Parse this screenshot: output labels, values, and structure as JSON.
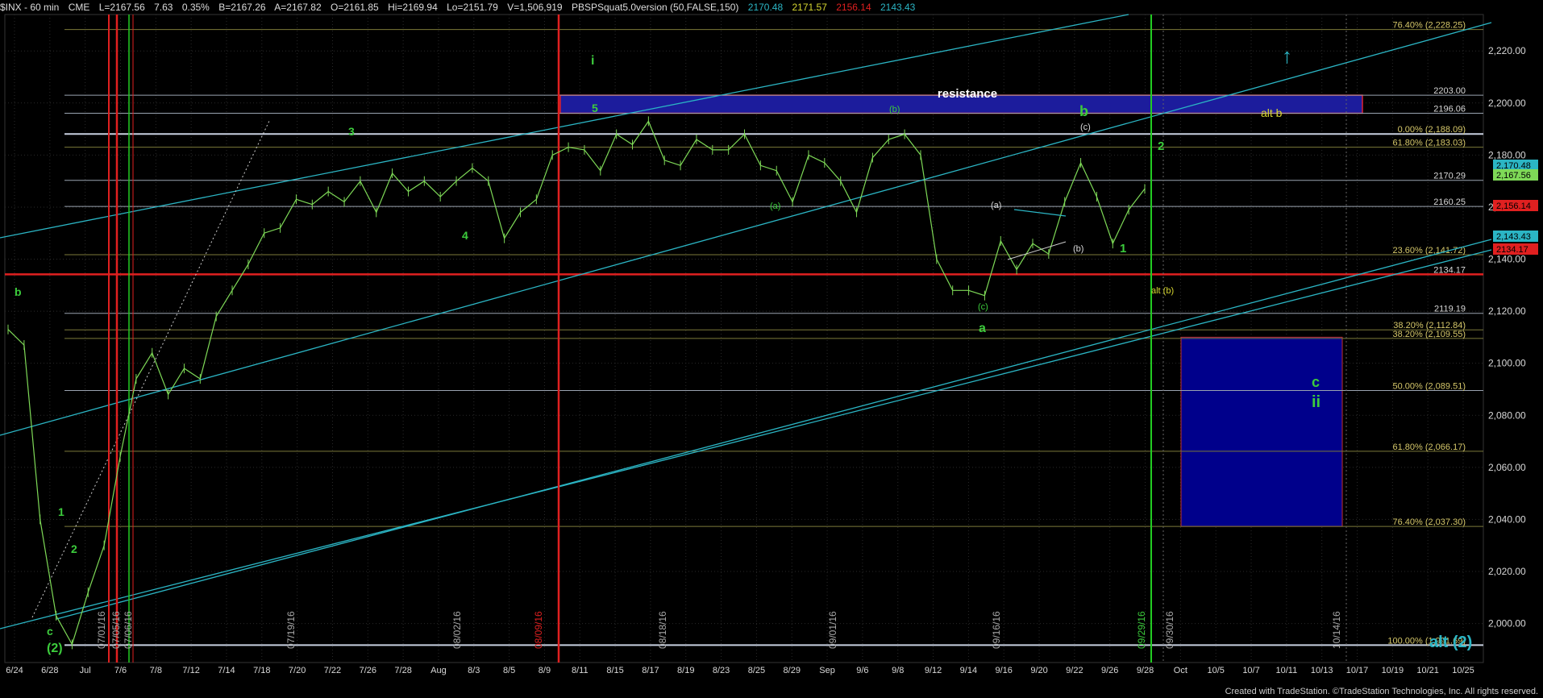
{
  "header": {
    "symbol": "$INX - 60 min",
    "exchange": "CME",
    "last": "L=2167.56",
    "change": "7.63",
    "change_pct": "0.35%",
    "bid": "B=2167.26",
    "ask": "A=2167.82",
    "open": "O=2161.85",
    "high": "Hi=2169.94",
    "low": "Lo=2151.79",
    "volume": "V=1,506,919",
    "study": "PBSPSquat5.0version (50,FALSE,150)",
    "study_v1": "2170.48",
    "study_v2": "2171.57",
    "study_v3": "2156.14",
    "study_v4": "2143.43"
  },
  "colors": {
    "background": "#000000",
    "price_bar": "#7ed957",
    "channel": "#2bb5c4",
    "red_line": "#e02020",
    "green_line": "#22cc22",
    "grey_line": "#9aa3b0",
    "olive_line": "#7c7a3a",
    "resistance_fill": "#1c1c9c",
    "target_box_fill": "#00008b",
    "label_green": "#3ccc3c",
    "label_white": "#d8d8d8",
    "label_yellow": "#d6d630"
  },
  "credits": "Created with TradeStation. ©TradeStation Technologies, Inc. All rights reserved.",
  "chart_data": {
    "type": "line",
    "title": "$INX - 60 min",
    "y_axis": {
      "ylim": [
        1985,
        2234
      ],
      "ticks": [
        "2,000.00",
        "2,020.00",
        "2,040.00",
        "2,060.00",
        "2,080.00",
        "2,100.00",
        "2,120.00",
        "2,140.00",
        "2,160.00",
        "2,180.00",
        "2,200.00",
        "2,220.00"
      ]
    },
    "x_axis": {
      "ticks": [
        "6/24",
        "6/28",
        "Jul",
        "7/6",
        "7/8",
        "7/12",
        "7/14",
        "7/18",
        "7/20",
        "7/22",
        "7/26",
        "7/28",
        "Aug",
        "8/3",
        "8/5",
        "8/9",
        "8/11",
        "8/15",
        "8/17",
        "8/19",
        "8/23",
        "8/25",
        "8/29",
        "Sep",
        "9/6",
        "9/8",
        "9/12",
        "9/14",
        "9/16",
        "9/20",
        "9/22",
        "9/26",
        "9/28",
        "Oct",
        "10/5",
        "10/7",
        "10/11",
        "10/13",
        "10/17",
        "10/19",
        "10/21",
        "10/25"
      ],
      "vertical_date_labels": [
        "07/01/16",
        "07/05/16",
        "07/06/16",
        "07/19/16",
        "08/02/16",
        "08/09/16",
        "08/18/16",
        "09/01/16",
        "09/16/16",
        "09/29/16",
        "09/30/16",
        "10/14/16"
      ]
    },
    "series": [
      {
        "name": "$INX",
        "points": [
          [
            "6/24",
            2113
          ],
          [
            "6/24",
            2107
          ],
          [
            "6/27",
            2040
          ],
          [
            "6/27",
            2003
          ],
          [
            "6/28",
            1992
          ],
          [
            "6/28",
            2012
          ],
          [
            "6/29",
            2030
          ],
          [
            "6/30",
            2064
          ],
          [
            "7/1",
            2094
          ],
          [
            "7/1",
            2104
          ],
          [
            "7/5",
            2088
          ],
          [
            "7/6",
            2098
          ],
          [
            "7/7",
            2094
          ],
          [
            "7/8",
            2118
          ],
          [
            "7/8",
            2128
          ],
          [
            "7/11",
            2138
          ],
          [
            "7/12",
            2150
          ],
          [
            "7/13",
            2152
          ],
          [
            "7/14",
            2163
          ],
          [
            "7/15",
            2161
          ],
          [
            "7/18",
            2166
          ],
          [
            "7/19",
            2162
          ],
          [
            "7/20",
            2170
          ],
          [
            "7/21",
            2158
          ],
          [
            "7/22",
            2173
          ],
          [
            "7/25",
            2166
          ],
          [
            "7/26",
            2170
          ],
          [
            "7/27",
            2164
          ],
          [
            "7/28",
            2170
          ],
          [
            "7/29",
            2175
          ],
          [
            "8/1",
            2170
          ],
          [
            "8/2",
            2148
          ],
          [
            "8/3",
            2158
          ],
          [
            "8/4",
            2163
          ],
          [
            "8/5",
            2180
          ],
          [
            "8/8",
            2183
          ],
          [
            "8/9",
            2182
          ],
          [
            "8/10",
            2174
          ],
          [
            "8/11",
            2188
          ],
          [
            "8/12",
            2184
          ],
          [
            "8/15",
            2193
          ],
          [
            "8/16",
            2178
          ],
          [
            "8/17",
            2176
          ],
          [
            "8/18",
            2186
          ],
          [
            "8/19",
            2182
          ],
          [
            "8/22",
            2182
          ],
          [
            "8/23",
            2188
          ],
          [
            "8/24",
            2176
          ],
          [
            "8/25",
            2174
          ],
          [
            "8/26",
            2162
          ],
          [
            "8/29",
            2180
          ],
          [
            "8/30",
            2177
          ],
          [
            "8/31",
            2170
          ],
          [
            "9/1",
            2158
          ],
          [
            "9/2",
            2179
          ],
          [
            "9/6",
            2186
          ],
          [
            "9/7",
            2188
          ],
          [
            "9/8",
            2180
          ],
          [
            "9/9",
            2140
          ],
          [
            "9/12",
            2128
          ],
          [
            "9/13",
            2128
          ],
          [
            "9/14",
            2126
          ],
          [
            "9/15",
            2147
          ],
          [
            "9/16",
            2136
          ],
          [
            "9/19",
            2146
          ],
          [
            "9/20",
            2142
          ],
          [
            "9/21",
            2162
          ],
          [
            "9/22",
            2177
          ],
          [
            "9/23",
            2164
          ],
          [
            "9/26",
            2146
          ],
          [
            "9/27",
            2159
          ],
          [
            "9/28",
            2167
          ]
        ]
      }
    ],
    "horizontal_levels": [
      {
        "label": "76.40% (2,228.25)",
        "value": 2228.25
      },
      {
        "label": "2203.00",
        "value": 2203.0
      },
      {
        "label": "2196.06",
        "value": 2196.06
      },
      {
        "label": "0.00% (2,188.09)",
        "value": 2188.09
      },
      {
        "label": "61.80% (2,183.03)",
        "value": 2183.03
      },
      {
        "label": "2170.29",
        "value": 2170.29
      },
      {
        "label": "2160.25",
        "value": 2160.25
      },
      {
        "label": "23.60% (2,141.72)",
        "value": 2141.72
      },
      {
        "label": "2134.17",
        "value": 2134.17
      },
      {
        "label": "2119.19",
        "value": 2119.19
      },
      {
        "label": "38.20% (2,112.84)",
        "value": 2112.84
      },
      {
        "label": "38.20% (2,109.55)",
        "value": 2109.55
      },
      {
        "label": "50.00% (2,089.51)",
        "value": 2089.51
      },
      {
        "label": "61.80% (2,066.17)",
        "value": 2066.17
      },
      {
        "label": "76.40% (2,037.30)",
        "value": 2037.3
      },
      {
        "label": "100.00% (1,991.69)",
        "value": 1991.69
      }
    ],
    "price_tags": [
      {
        "label": "2,170.48",
        "color": "#2bb5c4"
      },
      {
        "label": "2,167.56",
        "color": "#7ed957"
      },
      {
        "label": "2,156.14",
        "color": "#e02020"
      },
      {
        "label": "2,143.43",
        "color": "#2bb5c4"
      },
      {
        "label": "2134.17",
        "color": "#e02020"
      }
    ],
    "annotations": [
      {
        "text": "resistance",
        "color": "#ffffff"
      },
      {
        "text": "alt b",
        "color": "#d6d630"
      },
      {
        "text": "alt (b)",
        "color": "#d6d630"
      },
      {
        "text": "alt (2)",
        "color": "#2bb5c4"
      },
      {
        "text": "i",
        "color": "#3ccc3c"
      },
      {
        "text": "5",
        "color": "#3ccc3c"
      },
      {
        "text": "3",
        "color": "#3ccc3c"
      },
      {
        "text": "4",
        "color": "#3ccc3c"
      },
      {
        "text": "b",
        "color": "#3ccc3c"
      },
      {
        "text": "c",
        "color": "#3ccc3c"
      },
      {
        "text": "(2)",
        "color": "#3ccc3c"
      },
      {
        "text": "1",
        "color": "#3ccc3c"
      },
      {
        "text": "2",
        "color": "#3ccc3c"
      },
      {
        "text": "(a)",
        "color": "#3ccc3c"
      },
      {
        "text": "(b)",
        "color": "#3ccc3c"
      },
      {
        "text": "(c)",
        "color": "#3ccc3c"
      },
      {
        "text": "a",
        "color": "#3ccc3c"
      },
      {
        "text": "(a)",
        "color": "#d8d8d8"
      },
      {
        "text": "(b)",
        "color": "#d8d8d8"
      },
      {
        "text": "(c)",
        "color": "#d8d8d8"
      },
      {
        "text": "b",
        "color": "#3ccc3c"
      },
      {
        "text": "1",
        "color": "#3ccc3c"
      },
      {
        "text": "2",
        "color": "#3ccc3c"
      },
      {
        "text": "c",
        "color": "#3ccc3c"
      },
      {
        "text": "ii",
        "color": "#3ccc3c"
      },
      {
        "text": "↑",
        "color": "#2bb5c4"
      }
    ],
    "target_box": {
      "from": 2110,
      "to": 2037.3
    }
  }
}
